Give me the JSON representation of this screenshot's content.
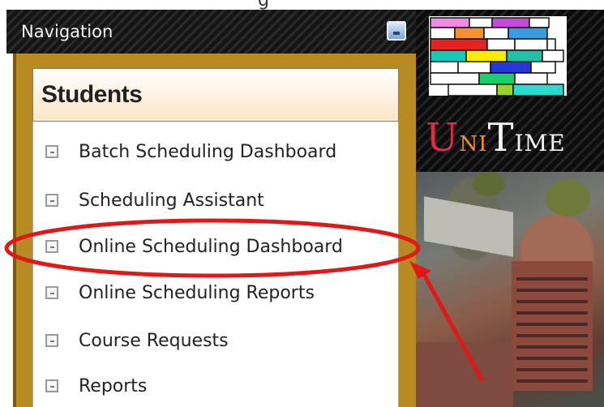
{
  "navigation": {
    "title": "Navigation",
    "collapse_icon": "collapse-toggle-icon"
  },
  "students": {
    "title": "Students",
    "items": [
      {
        "label": "Batch Scheduling Dashboard",
        "icon": "menu-bullet-icon"
      },
      {
        "label": "Scheduling Assistant",
        "icon": "menu-bullet-icon"
      },
      {
        "label": "Online Scheduling Dashboard",
        "icon": "menu-bullet-icon"
      },
      {
        "label": "Online Scheduling Reports",
        "icon": "menu-bullet-icon"
      },
      {
        "label": "Course Requests",
        "icon": "menu-bullet-icon"
      },
      {
        "label": "Reports",
        "icon": "menu-bullet-icon"
      }
    ]
  },
  "logo": {
    "part_u": "U",
    "part_ni": "NI",
    "part_t": "T",
    "part_ime": "IME"
  },
  "colors": {
    "panel_border": "#b88b22",
    "header_gradient_end": "#fde6c9",
    "annotation_red": "#e01818",
    "logo_red": "#e0294b"
  }
}
